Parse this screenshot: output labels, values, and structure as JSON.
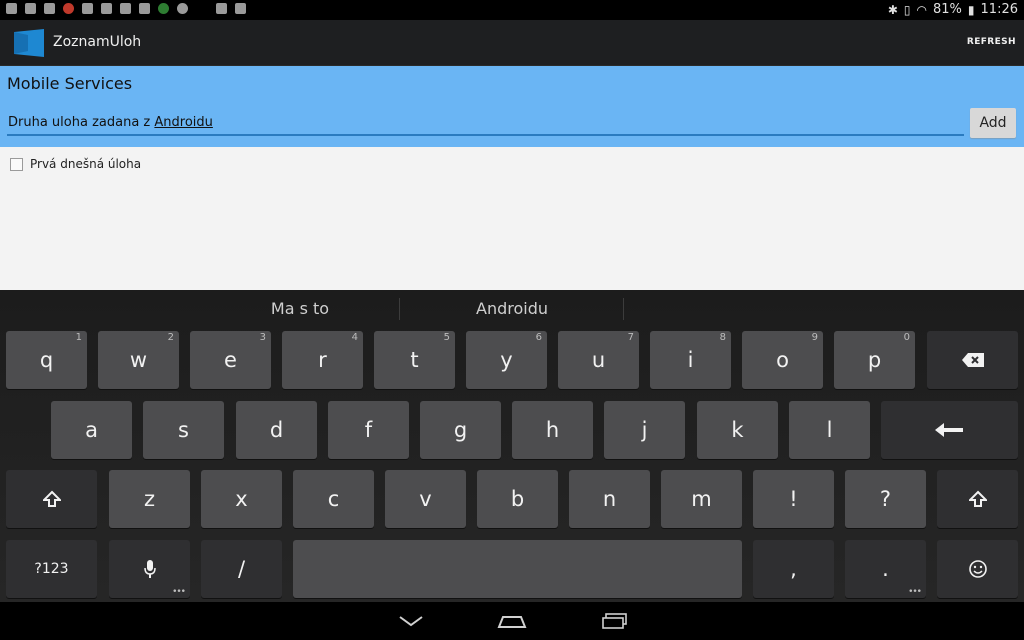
{
  "status_bar": {
    "battery": "81%",
    "time": "11:26"
  },
  "action_bar": {
    "app_title": "ZoznamUloh",
    "refresh_label": "REFRESH"
  },
  "header": {
    "title": "Mobile Services",
    "input_text_before": "Druha uloha zadana z ",
    "input_text_underlined": "Androidu",
    "add_label": "Add"
  },
  "todo_list": [
    {
      "label": "Prvá dnešná úloha",
      "checked": false
    }
  ],
  "keyboard": {
    "suggestions": [
      "Ma s to",
      "Androidu"
    ],
    "row1": [
      {
        "label": "q",
        "hint": "1"
      },
      {
        "label": "w",
        "hint": "2"
      },
      {
        "label": "e",
        "hint": "3"
      },
      {
        "label": "r",
        "hint": "4"
      },
      {
        "label": "t",
        "hint": "5"
      },
      {
        "label": "y",
        "hint": "6"
      },
      {
        "label": "u",
        "hint": "7"
      },
      {
        "label": "i",
        "hint": "8"
      },
      {
        "label": "o",
        "hint": "9"
      },
      {
        "label": "p",
        "hint": "0"
      }
    ],
    "row2": [
      "a",
      "s",
      "d",
      "f",
      "g",
      "h",
      "j",
      "k",
      "l"
    ],
    "row3": [
      "z",
      "x",
      "c",
      "v",
      "b",
      "n",
      "m",
      "!",
      "?"
    ],
    "symbols_label": "?123",
    "slash_label": "/",
    "comma_label": ",",
    "period_label": ".",
    "icons": {
      "backspace": "backspace-icon",
      "enter": "enter-icon",
      "shift": "shift-icon",
      "mic": "microphone-icon",
      "emoji": "emoji-icon"
    }
  },
  "colors": {
    "header_bg": "#6ab5f4",
    "input_underline": "#2a7bc0",
    "app_icon": "#1e88d2"
  }
}
